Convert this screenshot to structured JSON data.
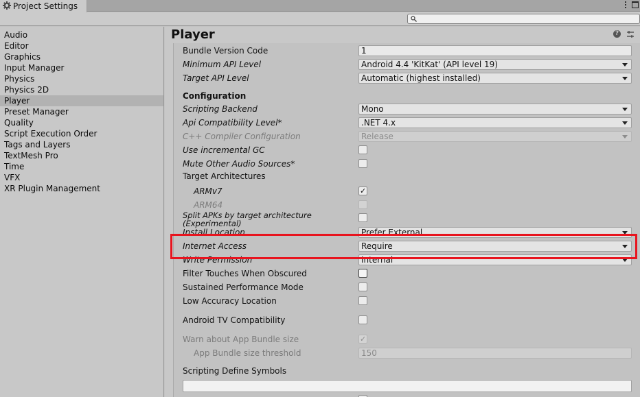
{
  "window": {
    "tab_title": "Project Settings",
    "menu_icon": "kebab-menu-icon",
    "maximize_icon": "maximize-icon"
  },
  "search": {
    "placeholder": "",
    "value": ""
  },
  "sidebar": {
    "items": [
      {
        "label": "Audio"
      },
      {
        "label": "Editor"
      },
      {
        "label": "Graphics"
      },
      {
        "label": "Input Manager"
      },
      {
        "label": "Physics"
      },
      {
        "label": "Physics 2D"
      },
      {
        "label": "Player"
      },
      {
        "label": "Preset Manager"
      },
      {
        "label": "Quality"
      },
      {
        "label": "Script Execution Order"
      },
      {
        "label": "Tags and Layers"
      },
      {
        "label": "TextMesh Pro"
      },
      {
        "label": "Time"
      },
      {
        "label": "VFX"
      },
      {
        "label": "XR Plugin Management"
      }
    ],
    "selected": "Player"
  },
  "main": {
    "title": "Player",
    "help_glyph": "?",
    "rows": {
      "bundle_version_code": {
        "label": "Bundle Version Code",
        "value": "1"
      },
      "min_api": {
        "label": "Minimum API Level",
        "value": "Android 4.4 'KitKat' (API level 19)"
      },
      "target_api": {
        "label": "Target API Level",
        "value": "Automatic (highest installed)"
      },
      "configuration": {
        "label": "Configuration"
      },
      "scripting_backend": {
        "label": "Scripting Backend",
        "value": "Mono"
      },
      "api_compat": {
        "label": "Api Compatibility Level*",
        "value": ".NET 4.x"
      },
      "cpp_config": {
        "label": "C++ Compiler Configuration",
        "value": "Release"
      },
      "incremental_gc": {
        "label": "Use incremental GC",
        "checked": false
      },
      "mute_audio": {
        "label": "Mute Other Audio Sources*",
        "checked": false
      },
      "target_arch": {
        "label": "Target Architectures"
      },
      "armv7": {
        "label": "ARMv7",
        "checked": true
      },
      "arm64": {
        "label": "ARM64",
        "checked": false
      },
      "split_apks": {
        "label_line1": "Split APKs by target architecture",
        "label_line2": "(Experimental)",
        "checked": false
      },
      "install_location": {
        "label": "Install Location",
        "value": "Prefer External"
      },
      "internet_access": {
        "label": "Internet Access",
        "value": "Require"
      },
      "write_permission": {
        "label": "Write Permission",
        "value": "Internal"
      },
      "filter_touches": {
        "label": "Filter Touches When Obscured",
        "checked": false
      },
      "sustained_perf": {
        "label": "Sustained Performance Mode",
        "checked": false
      },
      "low_accuracy": {
        "label": "Low Accuracy Location",
        "checked": false
      },
      "android_tv": {
        "label": "Android TV Compatibility",
        "checked": false
      },
      "warn_bundle": {
        "label": "Warn about App Bundle size",
        "checked": true
      },
      "bundle_threshold": {
        "label": "App Bundle size threshold",
        "value": "150"
      },
      "define_symbols": {
        "label": "Scripting Define Symbols",
        "value": ""
      }
    },
    "check_glyph": "✓"
  },
  "colors": {
    "highlight": "#e8141e",
    "background": "#c2c2c2",
    "sidebar_selected": "#b2b2b2"
  }
}
